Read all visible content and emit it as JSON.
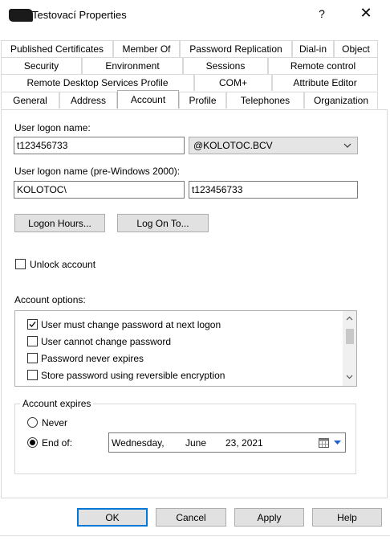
{
  "window": {
    "title": "Testovací Properties",
    "help_glyph": "?",
    "close_glyph": "✕"
  },
  "tabs": {
    "row1": [
      "Published Certificates",
      "Member Of",
      "Password Replication",
      "Dial-in",
      "Object"
    ],
    "row2": [
      "Security",
      "Environment",
      "Sessions",
      "Remote control"
    ],
    "row3": [
      "Remote Desktop Services Profile",
      "COM+",
      "Attribute Editor"
    ],
    "row4": [
      "General",
      "Address",
      "Account",
      "Profile",
      "Telephones",
      "Organization"
    ],
    "active": "Account"
  },
  "account": {
    "logon_name_label": "User logon name:",
    "logon_name_value": "t123456733",
    "domain_suffix": "@KOLOTOC.BCV",
    "pre2000_label": "User logon name (pre-Windows 2000):",
    "pre2000_domain": "KOLOTOC\\",
    "pre2000_name": "t123456733",
    "logon_hours_button": "Logon Hours...",
    "logon_to_button": "Log On To...",
    "unlock_label": "Unlock account",
    "options_label": "Account options:",
    "options": [
      {
        "label": "User must change password at next logon",
        "checked": true
      },
      {
        "label": "User cannot change password",
        "checked": false
      },
      {
        "label": "Password never expires",
        "checked": false
      },
      {
        "label": "Store password using reversible encryption",
        "checked": false
      }
    ],
    "expires_group": "Account expires",
    "never_label": "Never",
    "end_of_label": "End of:",
    "date_weekday": "Wednesday,",
    "date_month": "June",
    "date_day_year": "23, 2021"
  },
  "footer": {
    "ok": "OK",
    "cancel": "Cancel",
    "apply": "Apply",
    "help": "Help"
  }
}
